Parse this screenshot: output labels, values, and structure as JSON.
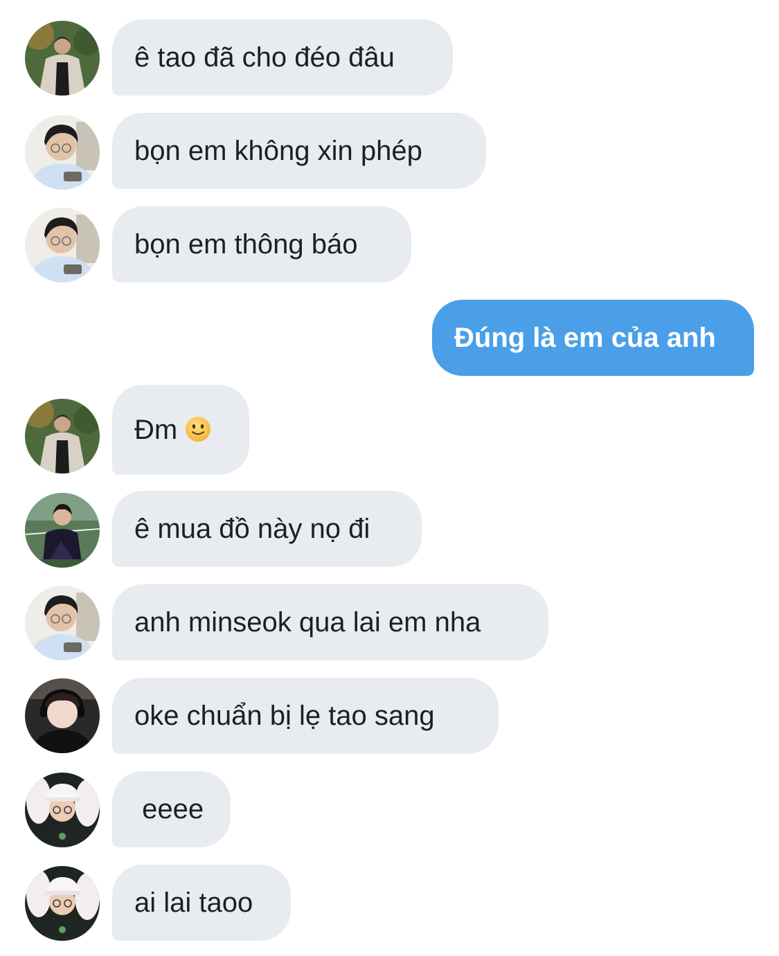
{
  "messages": [
    {
      "text": "ê tao đã cho đéo đâu",
      "avatar": "avatar-a"
    },
    {
      "text": "bọn em không xin phép",
      "avatar": "avatar-b"
    },
    {
      "text": "bọn em thông báo",
      "avatar": "avatar-b"
    },
    {
      "text": "Đúng là em của anh",
      "outgoing": true
    },
    {
      "text": "Đm",
      "avatar": "avatar-a",
      "emoji": "slightly-smiling-face"
    },
    {
      "text": "ê mua đồ này nọ đi",
      "avatar": "avatar-c"
    },
    {
      "text": "anh minseok qua lai em nha",
      "avatar": "avatar-b"
    },
    {
      "text": "oke chuẩn bị lẹ tao sang",
      "avatar": "avatar-d"
    },
    {
      "text": " eeee",
      "avatar": "avatar-e"
    },
    {
      "text": "ai lai taoo",
      "avatar": "avatar-e"
    }
  ],
  "colors": {
    "incoming_bubble": "#e8ebf0",
    "outgoing_bubble": "#4a9fe8",
    "background": "#ffffff"
  }
}
